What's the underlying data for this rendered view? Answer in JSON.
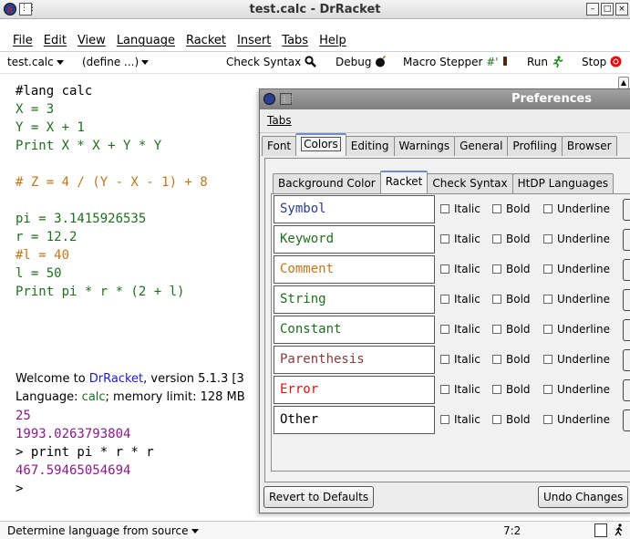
{
  "window": {
    "title": "test.calc - DrRacket",
    "buttons": [
      "–",
      "□",
      "×"
    ]
  },
  "menubar": [
    "File",
    "Edit",
    "View",
    "Language",
    "Racket",
    "Insert",
    "Tabs",
    "Help"
  ],
  "toolbar": {
    "file_menu": "test.calc",
    "define_menu": "(define ...)",
    "check_syntax": "Check Syntax",
    "debug": "Debug",
    "macro_stepper": "Macro Stepper",
    "macro_suffix": "#'",
    "run": "Run",
    "stop": "Stop"
  },
  "editor": {
    "lines": [
      {
        "text": "#lang calc",
        "color": "#000000"
      },
      {
        "text": "X = 3",
        "color": "#1f6e1f"
      },
      {
        "text": "Y = X + 1",
        "color": "#1f6e1f"
      },
      {
        "text": "Print X * X + Y * Y",
        "color": "#1f6e1f"
      },
      {
        "text": "",
        "color": "#000000"
      },
      {
        "text": "# Z = 4 / (Y - X - 1) + 8",
        "color": "#c2761b"
      },
      {
        "text": "",
        "color": "#000000"
      },
      {
        "text": "pi = 3.1415926535",
        "color": "#1f6e1f"
      },
      {
        "text": "r = 12.2",
        "color": "#1f6e1f"
      },
      {
        "text": "#l = 40",
        "color": "#c2761b"
      },
      {
        "text": "l = 50",
        "color": "#1f6e1f"
      },
      {
        "text": "Print pi * r * (2 + l)",
        "color": "#1f6e1f"
      }
    ]
  },
  "repl": {
    "welcome_prefix": "Welcome to ",
    "welcome_link": "DrRacket",
    "welcome_suffix": ", version 5.1.3 [3",
    "language_prefix": "Language: ",
    "language_name": "calc",
    "language_suffix": "; memory limit: 128 MB",
    "out1": "25",
    "out2": "1993.0263793804",
    "prompt1": "> print pi * r * r",
    "out3": "467.59465054694",
    "prompt2": ">",
    "link_color": "#1a1adb",
    "language_color": "#1f6e1f",
    "output_color": "#8a1a8a"
  },
  "statusbar": {
    "language": "Determine language from source",
    "position": "7:2"
  },
  "preferences": {
    "title": "Preferences",
    "menu": "Tabs",
    "tabs": [
      "Font",
      "Colors",
      "Editing",
      "Warnings",
      "General",
      "Profiling",
      "Browser"
    ],
    "active_tab": "Colors",
    "subtabs": [
      "Background Color",
      "Racket",
      "Check Syntax",
      "HtDP Languages"
    ],
    "active_subtab": "Racket",
    "styles": [
      {
        "name": "Symbol",
        "color": "#2a3a8e"
      },
      {
        "name": "Keyword",
        "color": "#1f6e1f"
      },
      {
        "name": "Comment",
        "color": "#c2761b"
      },
      {
        "name": "String",
        "color": "#1f6e1f"
      },
      {
        "name": "Constant",
        "color": "#1f6e1f"
      },
      {
        "name": "Parenthesis",
        "color": "#8a3a3a"
      },
      {
        "name": "Error",
        "color": "#e01010"
      },
      {
        "name": "Other",
        "color": "#000000"
      }
    ],
    "options": {
      "italic": "Italic",
      "bold": "Bold",
      "underline": "Underline"
    },
    "revert_button": "Revert to Defaults",
    "undo_button": "Undo Changes"
  }
}
